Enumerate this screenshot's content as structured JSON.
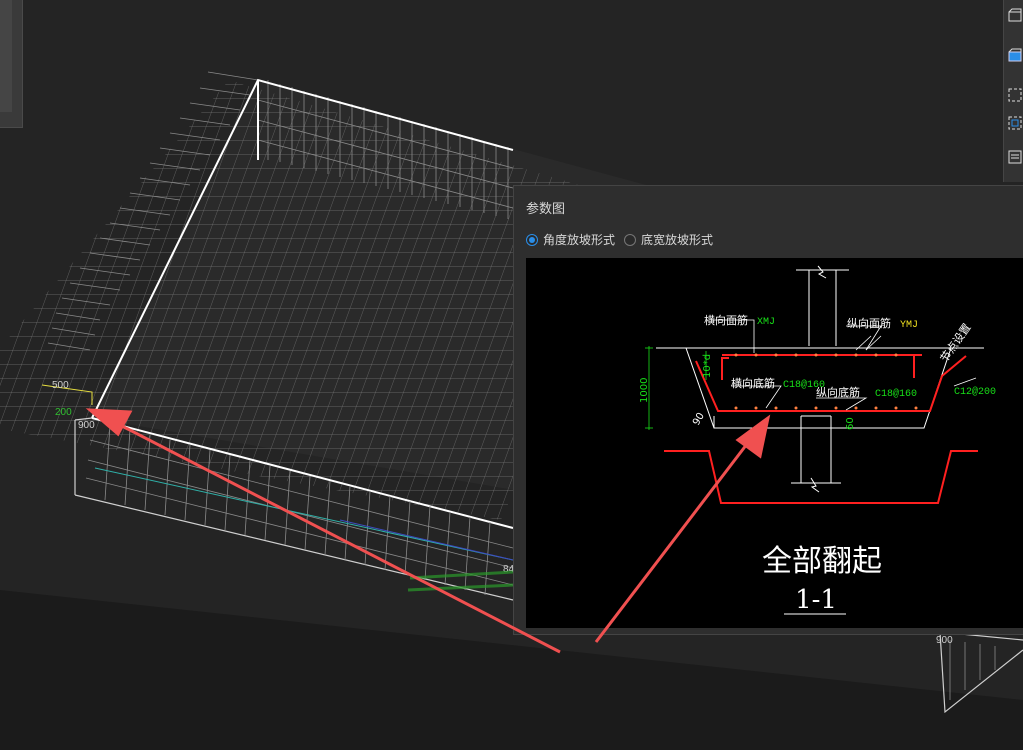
{
  "dialog": {
    "title": "参数图",
    "radios": [
      {
        "label": "角度放坡形式",
        "checked": true
      },
      {
        "label": "底宽放坡形式",
        "checked": false
      }
    ]
  },
  "viewport_labels": {
    "dim_500": "500",
    "dim_200": "200",
    "dim_900": "900",
    "dim_84": "84",
    "dim_900b": "900"
  },
  "figure": {
    "transverse_top": "横向面筋",
    "transverse_top_code": "XMJ",
    "longitudinal_top": "纵向面筋",
    "longitudinal_top_code": "YMJ",
    "transverse_bottom": "横向底筋",
    "transverse_bottom_code": "C18@160",
    "longitudinal_bottom": "纵向底筋",
    "longitudinal_bottom_code": "C18@160",
    "slope_rebar": "C12@200",
    "slope_note": "节点设置",
    "dim_10d": "10*d",
    "dim_1000": "1000",
    "dim_90": "90",
    "dim_60": "60",
    "caption": "全部翻起",
    "section": "1-1"
  },
  "colors": {
    "rebar": "#ff2020",
    "dimension": "#18e018",
    "code_yellow": "#f0e020",
    "highlight": "#2a8ee8",
    "arrow": "#f05050"
  }
}
